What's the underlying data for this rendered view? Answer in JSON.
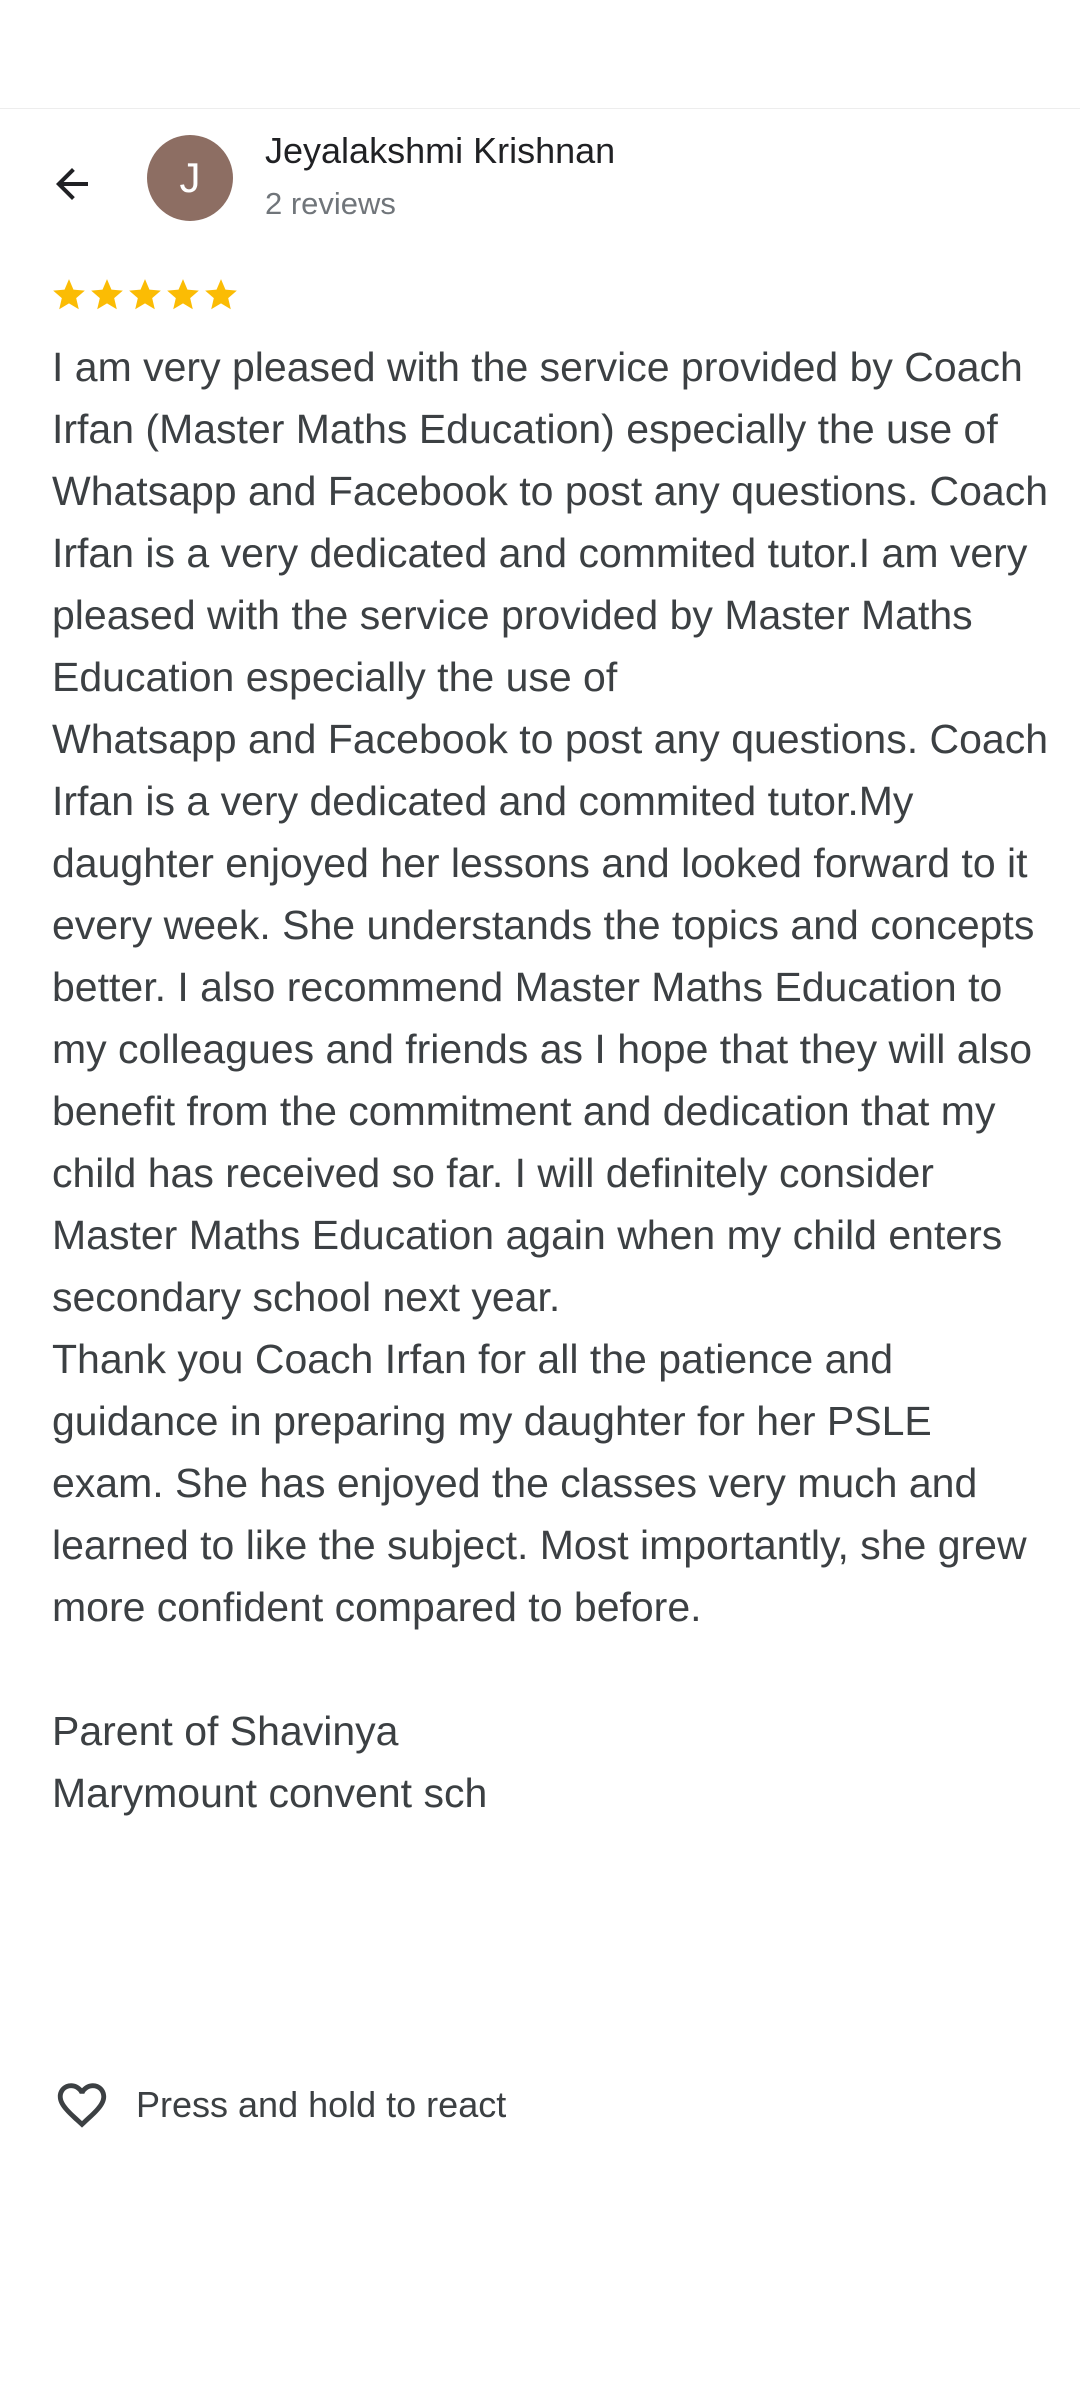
{
  "colors": {
    "avatar_bg": "#8d6e63",
    "star": "#fbbc04",
    "text": "#3c4043",
    "icon": "#202124"
  },
  "header": {
    "back_icon": "arrow-back-icon",
    "avatar_initial": "J",
    "reviewer_name": "Jeyalakshmi Krishnan",
    "review_count": "2 reviews"
  },
  "review": {
    "rating": 5,
    "rating_max": 5,
    "text": "I am very pleased with the service provided by Coach Irfan (Master Maths Education)  especially the use of Whatsapp and Facebook to post any questions. Coach Irfan is a very dedicated and commited tutor.I am very pleased with the service provided by Master Maths Education especially the use of\nWhatsapp and Facebook to post any questions. Coach Irfan is a very dedicated and commited tutor.My daughter enjoyed her lessons and looked forward to it every week. She understands the topics and concepts better. I also recommend Master Maths Education to my colleagues and friends as I hope that they will also benefit from the commitment and dedication that my child has received so far. I will definitely consider Master Maths Education again when my child enters secondary school next year.\nThank you Coach Irfan for all the patience and guidance in preparing my daughter for her PSLE exam. She has enjoyed the classes very much and learned to like the subject. Most importantly, she grew more confident compared to before.\n\nParent of Shavinya\nMarymount convent sch"
  },
  "reaction": {
    "icon": "heart-outline-icon",
    "label": "Press and hold to react"
  }
}
